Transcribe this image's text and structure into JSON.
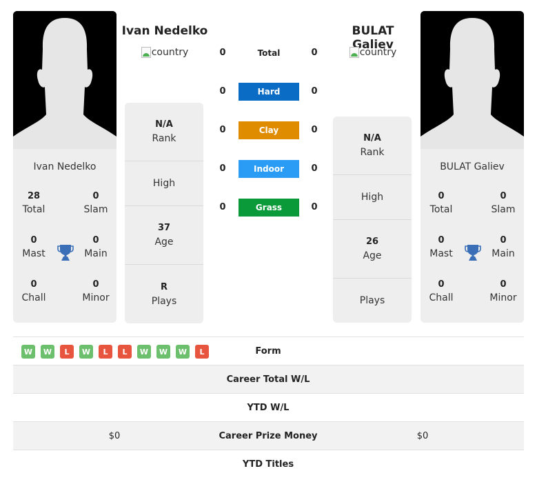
{
  "player1": {
    "name": "Ivan Nedelko",
    "country_alt": "country",
    "card_name": "Ivan Nedelko",
    "titles": {
      "total": {
        "value": "28",
        "label": "Total"
      },
      "slam": {
        "value": "0",
        "label": "Slam"
      },
      "mast": {
        "value": "0",
        "label": "Mast"
      },
      "main": {
        "value": "0",
        "label": "Main"
      },
      "chall": {
        "value": "0",
        "label": "Chall"
      },
      "minor": {
        "value": "0",
        "label": "Minor"
      }
    },
    "info": {
      "rank": {
        "value": "N/A",
        "label": "Rank"
      },
      "high": {
        "value": "",
        "label": "High"
      },
      "age": {
        "value": "37",
        "label": "Age"
      },
      "plays": {
        "value": "R",
        "label": "Plays"
      }
    }
  },
  "player2": {
    "name": "BULAT Galiev",
    "country_alt": "country",
    "card_name": "BULAT Galiev",
    "titles": {
      "total": {
        "value": "0",
        "label": "Total"
      },
      "slam": {
        "value": "0",
        "label": "Slam"
      },
      "mast": {
        "value": "0",
        "label": "Mast"
      },
      "main": {
        "value": "0",
        "label": "Main"
      },
      "chall": {
        "value": "0",
        "label": "Chall"
      },
      "minor": {
        "value": "0",
        "label": "Minor"
      }
    },
    "info": {
      "rank": {
        "value": "N/A",
        "label": "Rank"
      },
      "high": {
        "value": "",
        "label": "High"
      },
      "age": {
        "value": "26",
        "label": "Age"
      },
      "plays": {
        "value": "",
        "label": "Plays"
      }
    }
  },
  "h2h": [
    {
      "label": "Total",
      "left": "0",
      "right": "0",
      "color": ""
    },
    {
      "label": "Hard",
      "left": "0",
      "right": "0",
      "color": "#0a6cc4"
    },
    {
      "label": "Clay",
      "left": "0",
      "right": "0",
      "color": "#e08c00"
    },
    {
      "label": "Indoor",
      "left": "0",
      "right": "0",
      "color": "#2a9cf6"
    },
    {
      "label": "Grass",
      "left": "0",
      "right": "0",
      "color": "#0a9a3a"
    }
  ],
  "form": {
    "label": "Form",
    "results": [
      "W",
      "W",
      "L",
      "W",
      "L",
      "L",
      "W",
      "W",
      "W",
      "L"
    ],
    "win_color": "#6cbf6c",
    "loss_color": "#e8553e"
  },
  "stats": [
    {
      "label": "Career Total W/L",
      "left": "",
      "right": ""
    },
    {
      "label": "YTD W/L",
      "left": "",
      "right": ""
    },
    {
      "label": "Career Prize Money",
      "left": "$0",
      "right": "$0"
    },
    {
      "label": "YTD Titles",
      "left": "",
      "right": ""
    }
  ],
  "colors": {
    "panel_bg": "#eeeeee",
    "trophy": "#3a6fb8"
  }
}
